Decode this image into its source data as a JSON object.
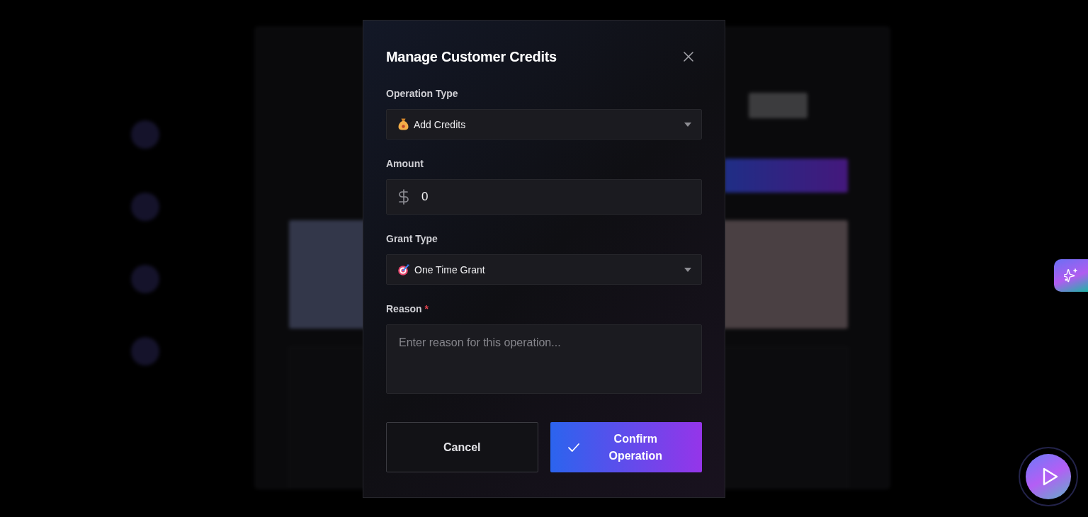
{
  "dialog": {
    "title": "Manage Customer Credits"
  },
  "form": {
    "operation_type": {
      "label": "Operation Type",
      "value": "Add Credits"
    },
    "amount": {
      "label": "Amount",
      "value": "0"
    },
    "grant_type": {
      "label": "Grant Type",
      "value": "One Time Grant"
    },
    "reason": {
      "label": "Reason",
      "required_mark": "*",
      "placeholder": "Enter reason for this operation..."
    }
  },
  "buttons": [
    {
      "label": "Cancel",
      "kind": "secondary"
    },
    {
      "label": "Confirm Operation",
      "kind": "primary"
    }
  ]
}
